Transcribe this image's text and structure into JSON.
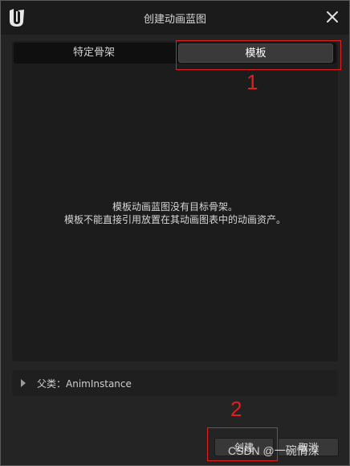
{
  "window": {
    "title": "创建动画蓝图"
  },
  "tabs": [
    {
      "label": "特定骨架",
      "selected": false
    },
    {
      "label": "模板",
      "selected": true
    }
  ],
  "message": {
    "line1": "模板动画蓝图没有目标骨架。",
    "line2": "模板不能直接引用放置在其动画图表中的动画资产。"
  },
  "parent_class": {
    "label": "父类：AnimInstance"
  },
  "buttons": {
    "create": "创建",
    "cancel": "取消"
  },
  "annotations": {
    "callout_1": "1",
    "callout_2": "2",
    "color": "#e02020"
  },
  "watermark": "CSDN @一碗情深",
  "icons": {
    "logo": "unreal-engine-logo",
    "close": "close-icon",
    "expand": "expand-arrow-icon"
  }
}
